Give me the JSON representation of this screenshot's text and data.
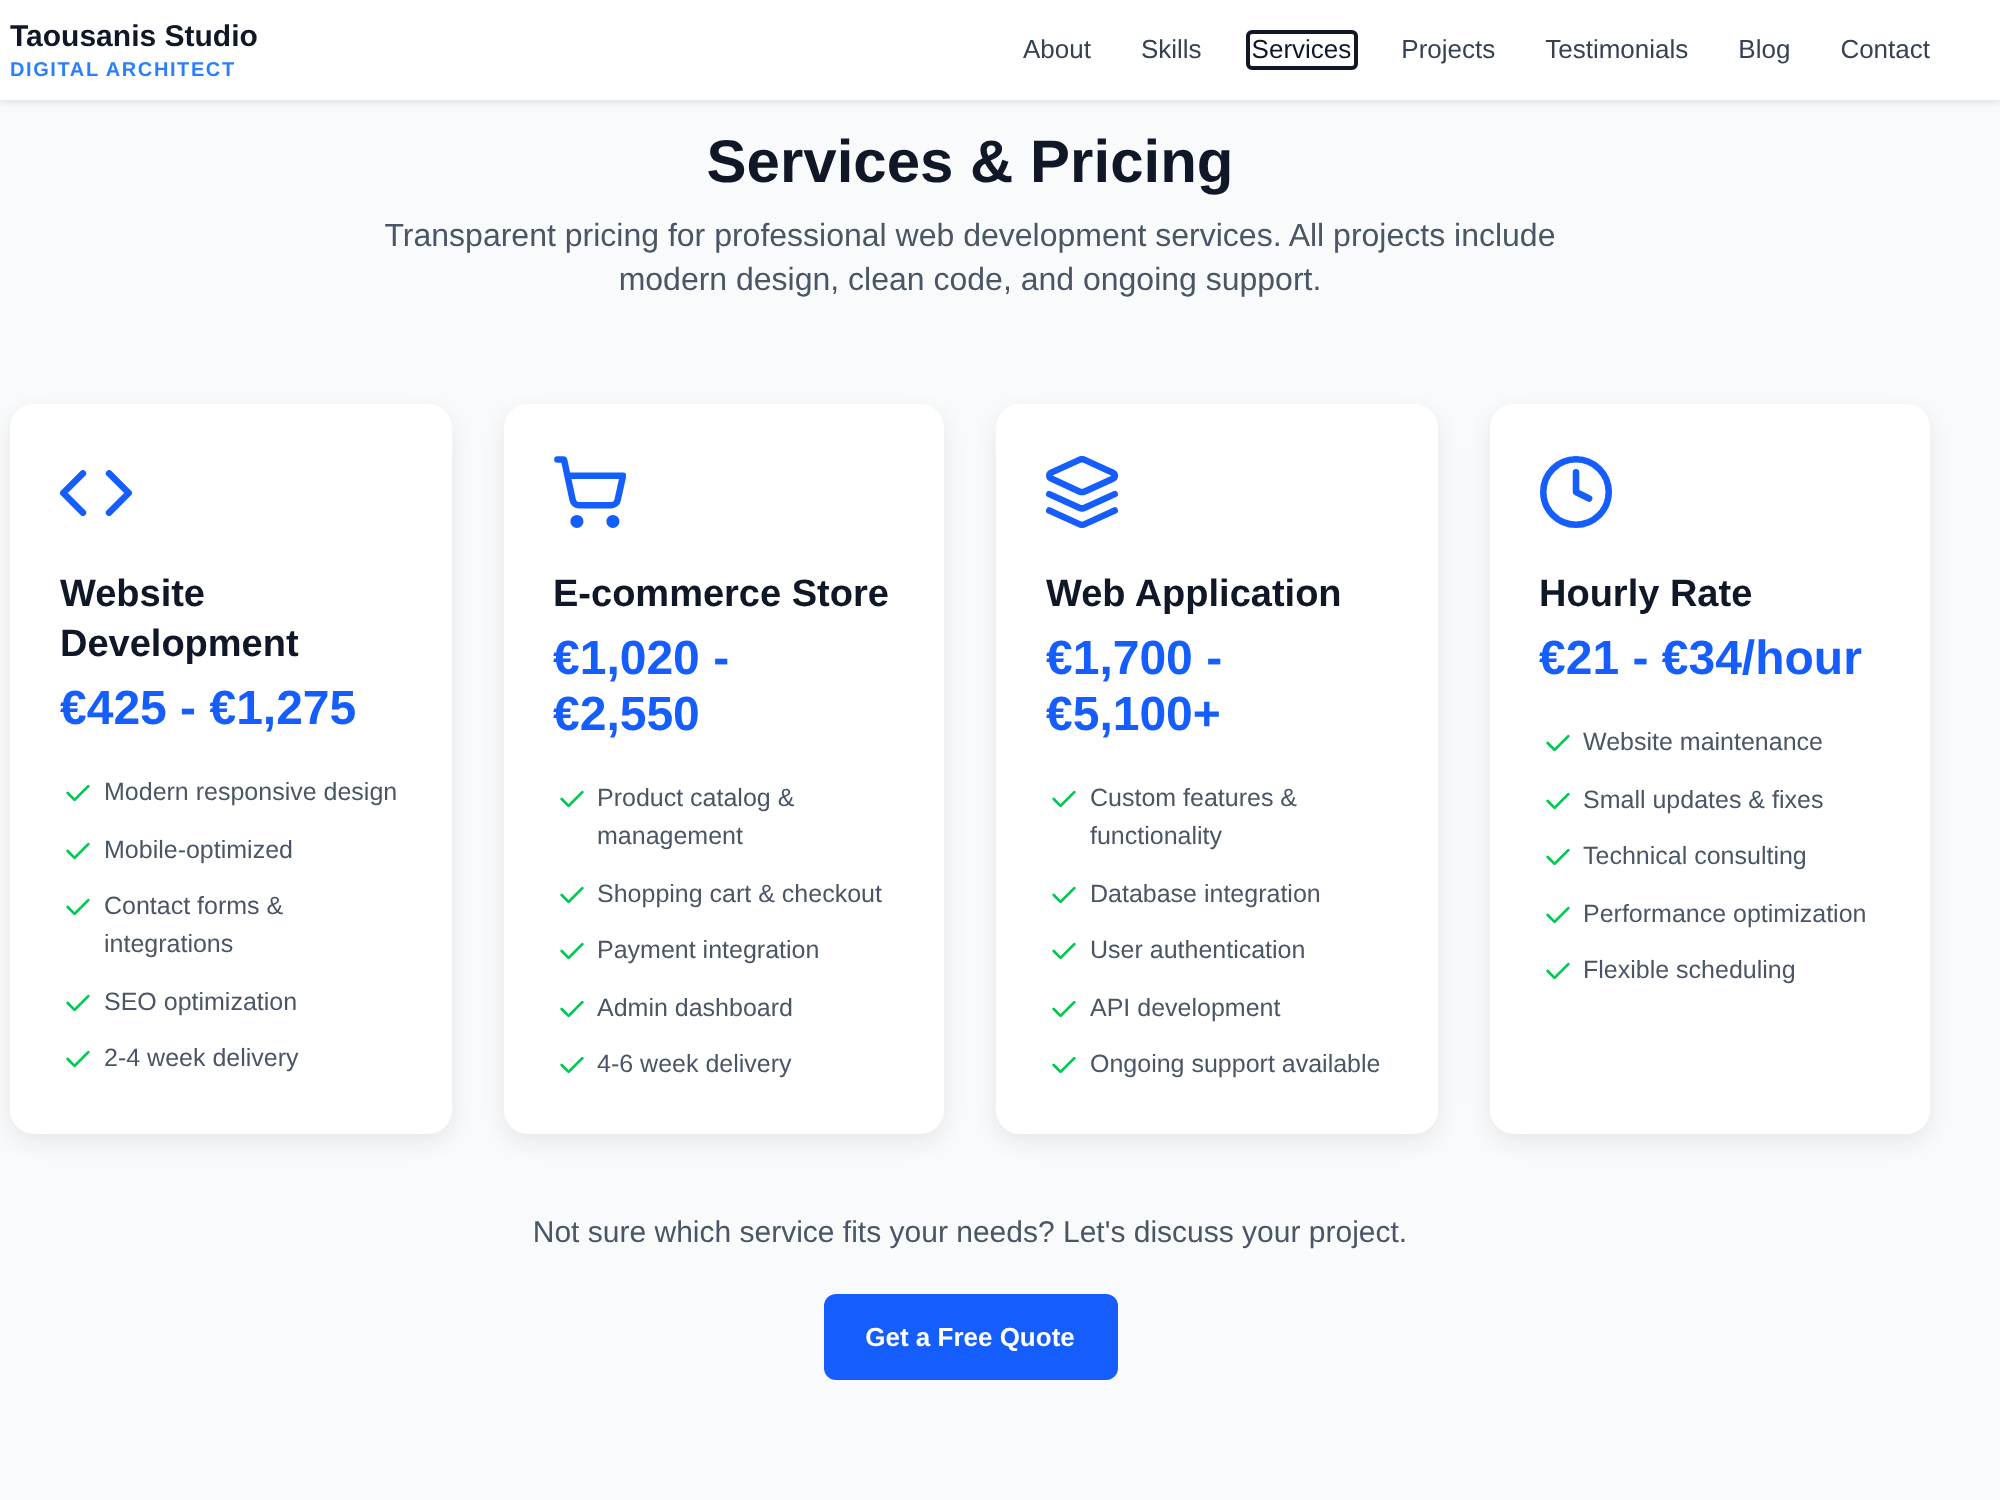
{
  "header": {
    "logo": {
      "title": "Taousanis Studio",
      "tagline": "DIGITAL ARCHITECT"
    },
    "nav": [
      {
        "label": "About",
        "selected": false
      },
      {
        "label": "Skills",
        "selected": false
      },
      {
        "label": "Services",
        "selected": true
      },
      {
        "label": "Projects",
        "selected": false
      },
      {
        "label": "Testimonials",
        "selected": false
      },
      {
        "label": "Blog",
        "selected": false
      },
      {
        "label": "Contact",
        "selected": false
      }
    ]
  },
  "section": {
    "title": "Services & Pricing",
    "subtitle": "Transparent pricing for professional web development services. All projects include modern design, clean code, and ongoing support."
  },
  "services": [
    {
      "title": "Website Development",
      "price": "€425 - €1,275",
      "features": [
        "Modern responsive design",
        "Mobile-optimized",
        "Contact forms & integrations",
        "SEO optimization",
        "2-4 week delivery"
      ]
    },
    {
      "title": "E-commerce Store",
      "price": "€1,020 - €2,550",
      "features": [
        "Product catalog & management",
        "Shopping cart & checkout",
        "Payment integration",
        "Admin dashboard",
        "4-6 week delivery"
      ]
    },
    {
      "title": "Web Application",
      "price": "€1,700 - €5,100+",
      "features": [
        "Custom features & functionality",
        "Database integration",
        "User authentication",
        "API development",
        "Ongoing support available"
      ]
    },
    {
      "title": "Hourly Rate",
      "price": "€21 - €34/hour",
      "features": [
        "Website maintenance",
        "Small updates & fixes",
        "Technical consulting",
        "Performance optimization",
        "Flexible scheduling"
      ]
    }
  ],
  "cta": {
    "text": "Not sure which service fits your needs? Let's discuss your project.",
    "button": "Get a Free Quote"
  }
}
